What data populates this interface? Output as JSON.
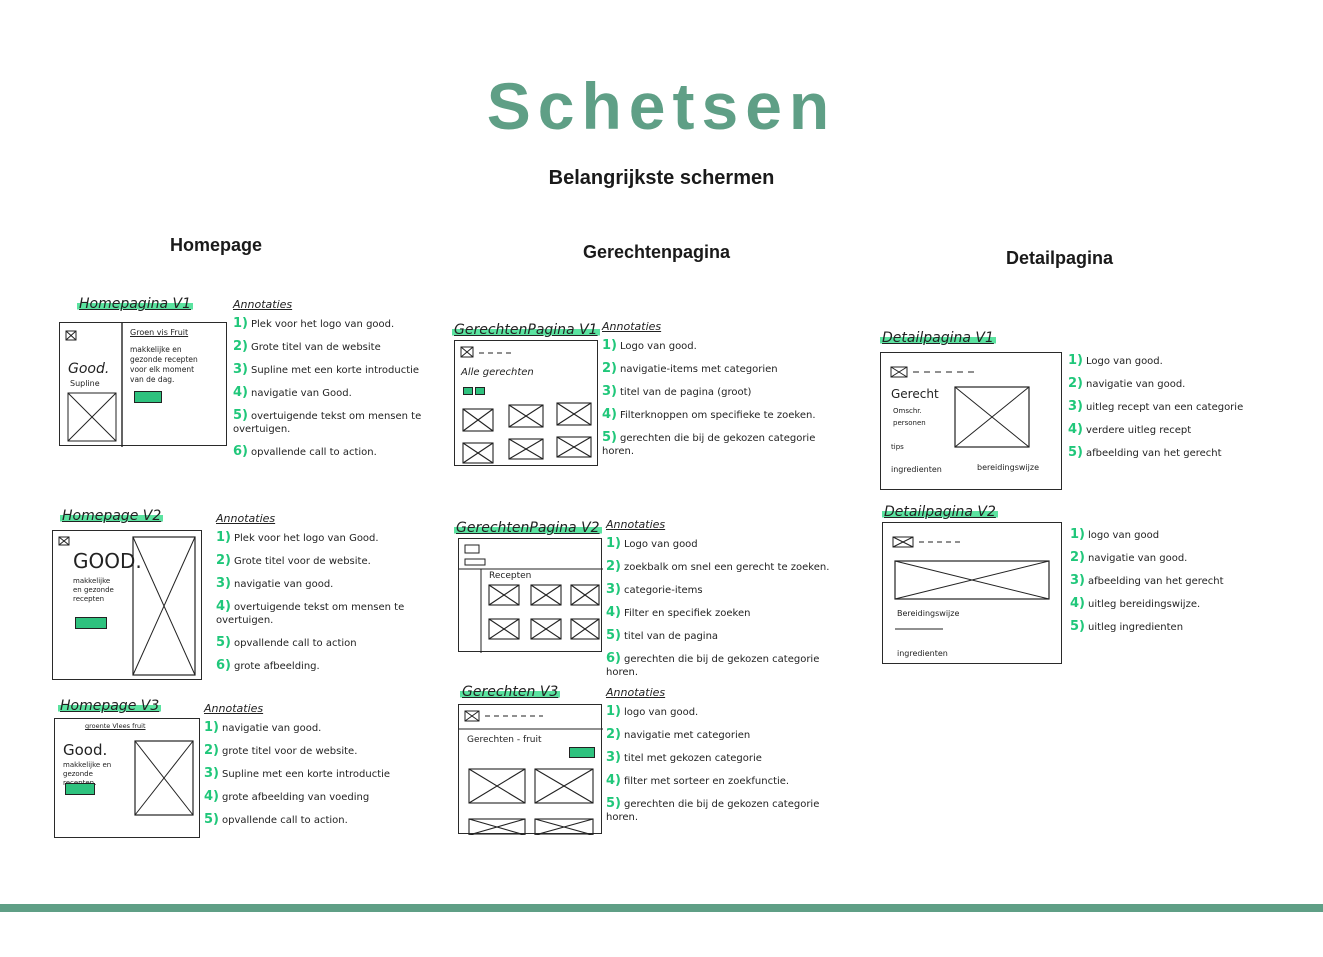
{
  "page": {
    "title": "Schetsen",
    "subtitle": "Belangrijkste schermen"
  },
  "columns": {
    "homepage": "Homepage",
    "gerechten": "Gerechtenpagina",
    "detail": "Detailpagina"
  },
  "colors": {
    "accent": "#5f9f86",
    "highlight": "#5be3a0",
    "numbers": "#20c77a"
  },
  "sketches": {
    "home_v1": {
      "title": "Homepagina V1",
      "ann_head": "Annotaties",
      "labels": {
        "brand": "Good.",
        "tagline": "Supline",
        "nav": "Groen vis Fruit",
        "intro": "makkelijke en gezonde recepten voor elk moment van de dag."
      },
      "annotations": [
        {
          "n": "1)",
          "t": "Plek voor het logo van good."
        },
        {
          "n": "2)",
          "t": "Grote titel van de website"
        },
        {
          "n": "3)",
          "t": "Supline met een korte introductie"
        },
        {
          "n": "4)",
          "t": "navigatie van Good."
        },
        {
          "n": "5)",
          "t": "overtuigende tekst om mensen te overtuigen."
        },
        {
          "n": "6)",
          "t": "opvallende call to action."
        }
      ]
    },
    "home_v2": {
      "title": "Homepage V2",
      "ann_head": "Annotaties",
      "labels": {
        "brand": "GOOD.",
        "intro": "makkelijke en gezonde recepten"
      },
      "annotations": [
        {
          "n": "1)",
          "t": "Plek voor het logo van Good."
        },
        {
          "n": "2)",
          "t": "Grote titel voor de website."
        },
        {
          "n": "3)",
          "t": "navigatie van good."
        },
        {
          "n": "4)",
          "t": "overtuigende tekst om mensen te overtuigen."
        },
        {
          "n": "5)",
          "t": "opvallende call to action"
        },
        {
          "n": "6)",
          "t": "grote afbeelding."
        }
      ]
    },
    "home_v3": {
      "title": "Homepage V3",
      "ann_head": "Annotaties",
      "labels": {
        "brand": "Good.",
        "intro": "makkelijke en gezonde recepten.",
        "nav": "groente Vlees fruit"
      },
      "annotations": [
        {
          "n": "1)",
          "t": "navigatie van good."
        },
        {
          "n": "2)",
          "t": "grote titel voor de website."
        },
        {
          "n": "3)",
          "t": "Supline met een korte introductie"
        },
        {
          "n": "4)",
          "t": "grote afbeelding van voeding"
        },
        {
          "n": "5)",
          "t": "opvallende call to action."
        }
      ]
    },
    "ger_v1": {
      "title": "GerechtenPagina V1",
      "ann_head": "Annotaties",
      "labels": {
        "heading": "Alle gerechten"
      },
      "annotations": [
        {
          "n": "1)",
          "t": "Logo van good."
        },
        {
          "n": "2)",
          "t": "navigatie-items met categorien"
        },
        {
          "n": "3)",
          "t": "titel van de pagina (groot)"
        },
        {
          "n": "4)",
          "t": "Filterknoppen om specifieke te zoeken."
        },
        {
          "n": "5)",
          "t": "gerechten die bij de gekozen categorie horen."
        }
      ]
    },
    "ger_v2": {
      "title": "GerechtenPagina V2",
      "ann_head": "Annotaties",
      "labels": {
        "heading": "Recepten"
      },
      "annotations": [
        {
          "n": "1)",
          "t": "Logo van good"
        },
        {
          "n": "2)",
          "t": "zoekbalk om snel een gerecht te zoeken."
        },
        {
          "n": "3)",
          "t": "categorie-items"
        },
        {
          "n": "4)",
          "t": "Filter en specifiek zoeken"
        },
        {
          "n": "5)",
          "t": "titel van de pagina"
        },
        {
          "n": "6)",
          "t": "gerechten die bij de gekozen categorie horen."
        }
      ]
    },
    "ger_v3": {
      "title": "Gerechten V3",
      "ann_head": "Annotaties",
      "labels": {
        "heading": "Gerechten - fruit"
      },
      "annotations": [
        {
          "n": "1)",
          "t": "logo van good."
        },
        {
          "n": "2)",
          "t": "navigatie met categorien"
        },
        {
          "n": "3)",
          "t": "titel met gekozen categorie"
        },
        {
          "n": "4)",
          "t": "filter met sorteer en zoekfunctie."
        },
        {
          "n": "5)",
          "t": "gerechten die bij de gekozen categorie horen."
        }
      ]
    },
    "det_v1": {
      "title": "Detailpagina V1",
      "labels": {
        "heading": "Gerecht",
        "meta1": "Omschr.",
        "meta2": "personen",
        "meta3": "tips",
        "ing": "ingredienten",
        "prep": "bereidingswijze"
      },
      "annotations": [
        {
          "n": "1)",
          "t": "Logo van good."
        },
        {
          "n": "2)",
          "t": "navigatie van good."
        },
        {
          "n": "3)",
          "t": "uitleg recept van een categorie"
        },
        {
          "n": "4)",
          "t": "verdere uitleg recept"
        },
        {
          "n": "5)",
          "t": "afbeelding van het gerecht"
        }
      ]
    },
    "det_v2": {
      "title": "Detailpagina V2",
      "labels": {
        "prep": "Bereidingswijze",
        "ing": "ingredienten"
      },
      "annotations": [
        {
          "n": "1)",
          "t": "logo van good"
        },
        {
          "n": "2)",
          "t": "navigatie van good."
        },
        {
          "n": "3)",
          "t": "afbeelding van het gerecht"
        },
        {
          "n": "4)",
          "t": "uitleg bereidingswijze."
        },
        {
          "n": "5)",
          "t": "uitleg ingredienten"
        }
      ]
    }
  }
}
